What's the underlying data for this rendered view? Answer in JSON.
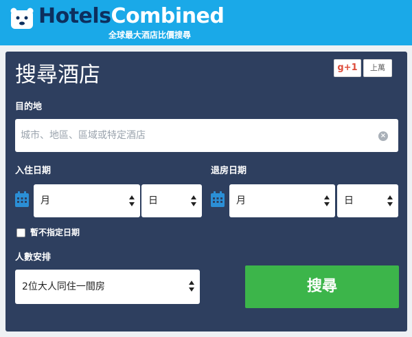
{
  "header": {
    "logo_prefix": "Hotels",
    "logo_suffix": "Combined",
    "tagline": "全球最大酒店比價搜尋"
  },
  "form": {
    "title": "搜尋酒店",
    "gplus_label": "g+1",
    "gplus_count": "上萬",
    "destination_label": "目的地",
    "destination_placeholder": "城市、地區、區域或特定酒店",
    "checkin_label": "入住日期",
    "checkout_label": "退房日期",
    "month_placeholder": "月",
    "day_placeholder": "日",
    "no_dates_label": "暫不指定日期",
    "guests_label": "人數安排",
    "guests_value": "2位大人同住一間房",
    "search_button": "搜尋"
  },
  "colors": {
    "header_bg": "#1aa9e8",
    "panel_bg": "#2e3f5f",
    "search_button": "#3cb54a",
    "gplus_red": "#dd4b39"
  },
  "icons": [
    "bear-logo-icon",
    "clear-icon",
    "calendar-icon",
    "select-arrows-icon"
  ]
}
